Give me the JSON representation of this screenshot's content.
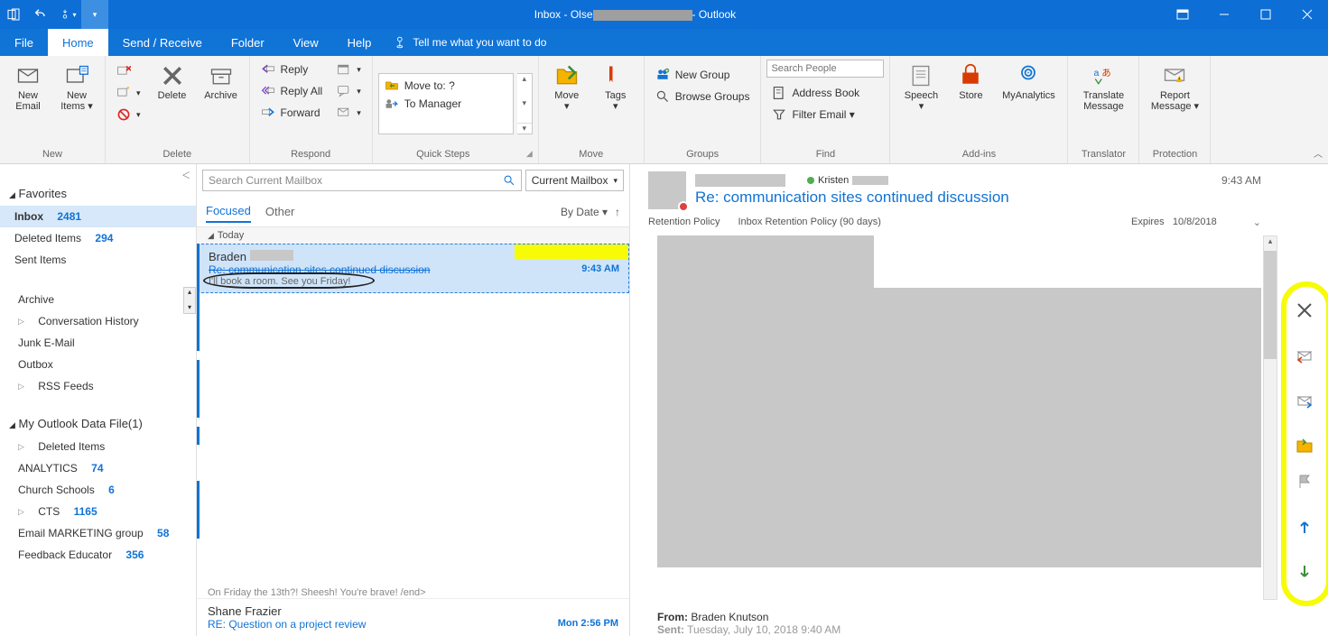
{
  "title": {
    "prefix": "Inbox - Olse",
    "suffix": "- Outlook"
  },
  "menu": {
    "file": "File",
    "home": "Home",
    "sendrecv": "Send / Receive",
    "folder": "Folder",
    "view": "View",
    "help": "Help",
    "tellme": "Tell me what you want to do"
  },
  "ribbon": {
    "new_group": "New",
    "new_email": "New\nEmail",
    "new_items": "New\nItems ▾",
    "delete_group": "Delete",
    "delete": "Delete",
    "archive": "Archive",
    "respond_group": "Respond",
    "reply": "Reply",
    "reply_all": "Reply All",
    "forward": "Forward",
    "quick_group": "Quick Steps",
    "move_to": "Move to: ?",
    "to_manager": "To Manager",
    "move_group": "Move",
    "move": "Move\n▾",
    "tags": "Tags\n▾",
    "groups_group": "Groups",
    "newgroup": "New Group",
    "browsegroups": "Browse Groups",
    "find_group": "Find",
    "search_people_ph": "Search People",
    "address_book": "Address Book",
    "filter_email": "Filter Email ▾",
    "addins_group": "Add-ins",
    "speech": "Speech\n▾",
    "store": "Store",
    "myanalytics": "MyAnalytics",
    "translator_group": "Translator",
    "translate": "Translate\nMessage",
    "protection_group": "Protection",
    "report": "Report\nMessage ▾"
  },
  "nav": {
    "favorites": "Favorites",
    "inbox": "Inbox",
    "inbox_count": "2481",
    "deleted": "Deleted Items",
    "deleted_count": "294",
    "sent": "Sent Items",
    "archive": "Archive",
    "convhist": "Conversation History",
    "junk": "Junk E-Mail",
    "outbox": "Outbox",
    "rss": "RSS Feeds",
    "datafile": "My Outlook Data File(1)",
    "deleted2": "Deleted Items",
    "analytics": "ANALYTICS",
    "analytics_count": "74",
    "church": "Church Schools",
    "church_count": "6",
    "cts": "CTS",
    "cts_count": "1165",
    "emailmkt": "Email MARKETING group",
    "emailmkt_count": "58",
    "feedback": "Feedback Educator",
    "feedback_count": "356"
  },
  "list": {
    "search_ph": "Search Current Mailbox",
    "scope": "Current Mailbox",
    "tab_focused": "Focused",
    "tab_other": "Other",
    "bydate": "By Date ▾",
    "today": "Today",
    "item1": {
      "from": "Braden",
      "subject": "Re: communication sites continued discussion",
      "time": "9:43 AM",
      "preview": "I'll book a room. See you Friday!"
    },
    "truncated": "On Friday the 13th?! Sheesh! You're brave!   /end>",
    "bottom": {
      "from": "Shane Frazier",
      "subject": "RE: Question on a project review",
      "time": "Mon 2:56 PM"
    }
  },
  "read": {
    "to_name": "Kristen",
    "subject": "Re: communication sites continued discussion",
    "time": "9:43 AM",
    "retention_label": "Retention Policy",
    "retention_policy": "Inbox Retention Policy (90 days)",
    "expires_label": "Expires",
    "expires": "10/8/2018",
    "from_label": "From:",
    "from_name": "Braden Knutson",
    "sent_label": "Sent:",
    "sent_value": "Tuesday, July 10, 2018 9:40 AM"
  }
}
